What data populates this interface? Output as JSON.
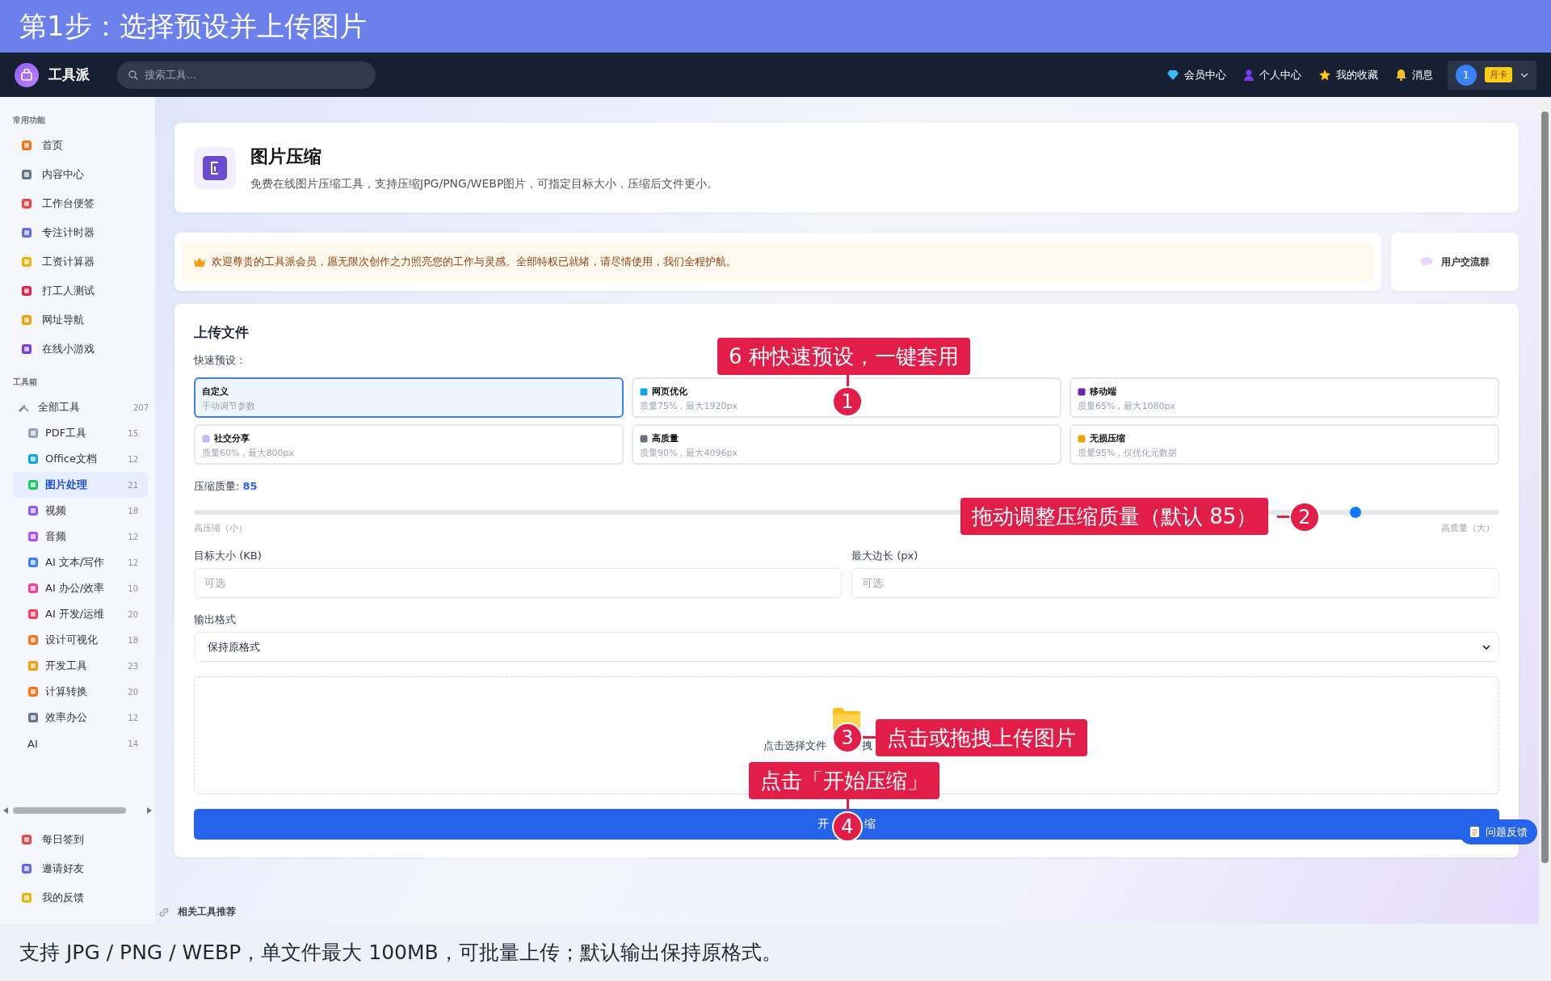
{
  "guide_title": "第1步：选择预设并上传图片",
  "header": {
    "app_name": "工具派",
    "search": {
      "placeholder": "搜索工具..."
    },
    "nav": [
      {
        "label": "会员中心"
      },
      {
        "label": "个人中心"
      },
      {
        "label": "我的收藏"
      },
      {
        "label": "消息"
      }
    ],
    "user": {
      "avatar": "1",
      "badge": "月卡"
    }
  },
  "sidebar": {
    "common": {
      "title": "常用功能",
      "items": [
        {
          "label": "首页"
        },
        {
          "label": "内容中心"
        },
        {
          "label": "工作台便签"
        },
        {
          "label": "专注计时器"
        },
        {
          "label": "工资计算器"
        },
        {
          "label": "打工人测试"
        },
        {
          "label": "网址导航"
        },
        {
          "label": "在线小游戏"
        }
      ]
    },
    "toolbox": {
      "title": "工具箱",
      "all": {
        "label": "全部工具",
        "count": "207"
      },
      "categories": [
        {
          "label": "PDF工具",
          "count": "15",
          "selected": false,
          "kind": "icon"
        },
        {
          "label": "Office文档",
          "count": "12",
          "selected": false,
          "kind": "icon"
        },
        {
          "label": "图片处理",
          "count": "21",
          "selected": true,
          "kind": "icon"
        },
        {
          "label": "视频",
          "count": "18",
          "selected": false,
          "kind": "icon"
        },
        {
          "label": "音频",
          "count": "12",
          "selected": false,
          "kind": "icon"
        },
        {
          "label": "AI 文本/写作",
          "count": "12",
          "selected": false,
          "kind": "icon"
        },
        {
          "label": "AI 办公/效率",
          "count": "10",
          "selected": false,
          "kind": "icon"
        },
        {
          "label": "AI 开发/运维",
          "count": "20",
          "selected": false,
          "kind": "icon"
        },
        {
          "label": "设计可视化",
          "count": "18",
          "selected": false,
          "kind": "icon"
        },
        {
          "label": "开发工具",
          "count": "23",
          "selected": false,
          "kind": "icon"
        },
        {
          "label": "计算转换",
          "count": "20",
          "selected": false,
          "kind": "icon"
        },
        {
          "label": "效率办公",
          "count": "12",
          "selected": false,
          "kind": "icon"
        },
        {
          "label": "AI",
          "count": "14",
          "selected": false,
          "kind": "plain"
        }
      ]
    },
    "bottom_items": [
      {
        "label": "每日签到"
      },
      {
        "label": "邀请好友"
      },
      {
        "label": "我的反馈"
      }
    ]
  },
  "tool": {
    "title": "图片压缩",
    "description": "免费在线图片压缩工具，支持压缩JPG/PNG/WEBP图片，可指定目标大小，压缩后文件更小。"
  },
  "notice": {
    "text": "欢迎尊贵的工具派会员，愿无限次创作之力照亮您的工作与灵感。全部特权已就绪，请尽情使用，我们全程护航。"
  },
  "community_button": {
    "label": "用户交流群"
  },
  "upload": {
    "title": "上传文件",
    "presets_label": "快速预设：",
    "presets": [
      {
        "name": "自定义",
        "detail": "手动调节参数",
        "selected": true,
        "kind": "plain"
      },
      {
        "name": "网页优化",
        "detail": "质量75%，最大1920px",
        "selected": false,
        "kind": "icon"
      },
      {
        "name": "移动端",
        "detail": "质量65%，最大1080px",
        "selected": false,
        "kind": "icon"
      },
      {
        "name": "社交分享",
        "detail": "质量60%，最大800px",
        "selected": false,
        "kind": "icon"
      },
      {
        "name": "高质量",
        "detail": "质量90%，最大4096px",
        "selected": false,
        "kind": "icon"
      },
      {
        "name": "无损压缩",
        "detail": "质量95%，仅优化元数据",
        "selected": false,
        "kind": "icon"
      }
    ],
    "quality": {
      "label": "压缩质量:",
      "value": "85",
      "level": 0.89,
      "min_label": "高压缩（小）",
      "max_label": "高质量（大）"
    },
    "target_size": {
      "label": "目标大小 (KB)",
      "placeholder": "可选"
    },
    "max_edge": {
      "label": "最大边长 (px)",
      "placeholder": "可选"
    },
    "format": {
      "label": "输出格式",
      "value": "保持原格式"
    },
    "dropzone": {
      "hint_start": "点击选择文件",
      "hint_end": "拽"
    },
    "submit": {
      "label_start": "开",
      "label_end": "缩"
    }
  },
  "feedback_button": {
    "label": "问题反馈"
  },
  "related": {
    "title": "相关工具推荐"
  },
  "callouts": [
    {
      "number": "1",
      "text": "6 种快速预设，一键套用"
    },
    {
      "number": "2",
      "text": "拖动调整压缩质量（默认 85）"
    },
    {
      "number": "3",
      "text": "点击或拖拽上传图片"
    },
    {
      "number": "4",
      "text": "点击「开始压缩」"
    }
  ],
  "caption": "支持 JPG / PNG / WEBP，单文件最大 100MB，可批量上传；默认输出保持原格式。"
}
